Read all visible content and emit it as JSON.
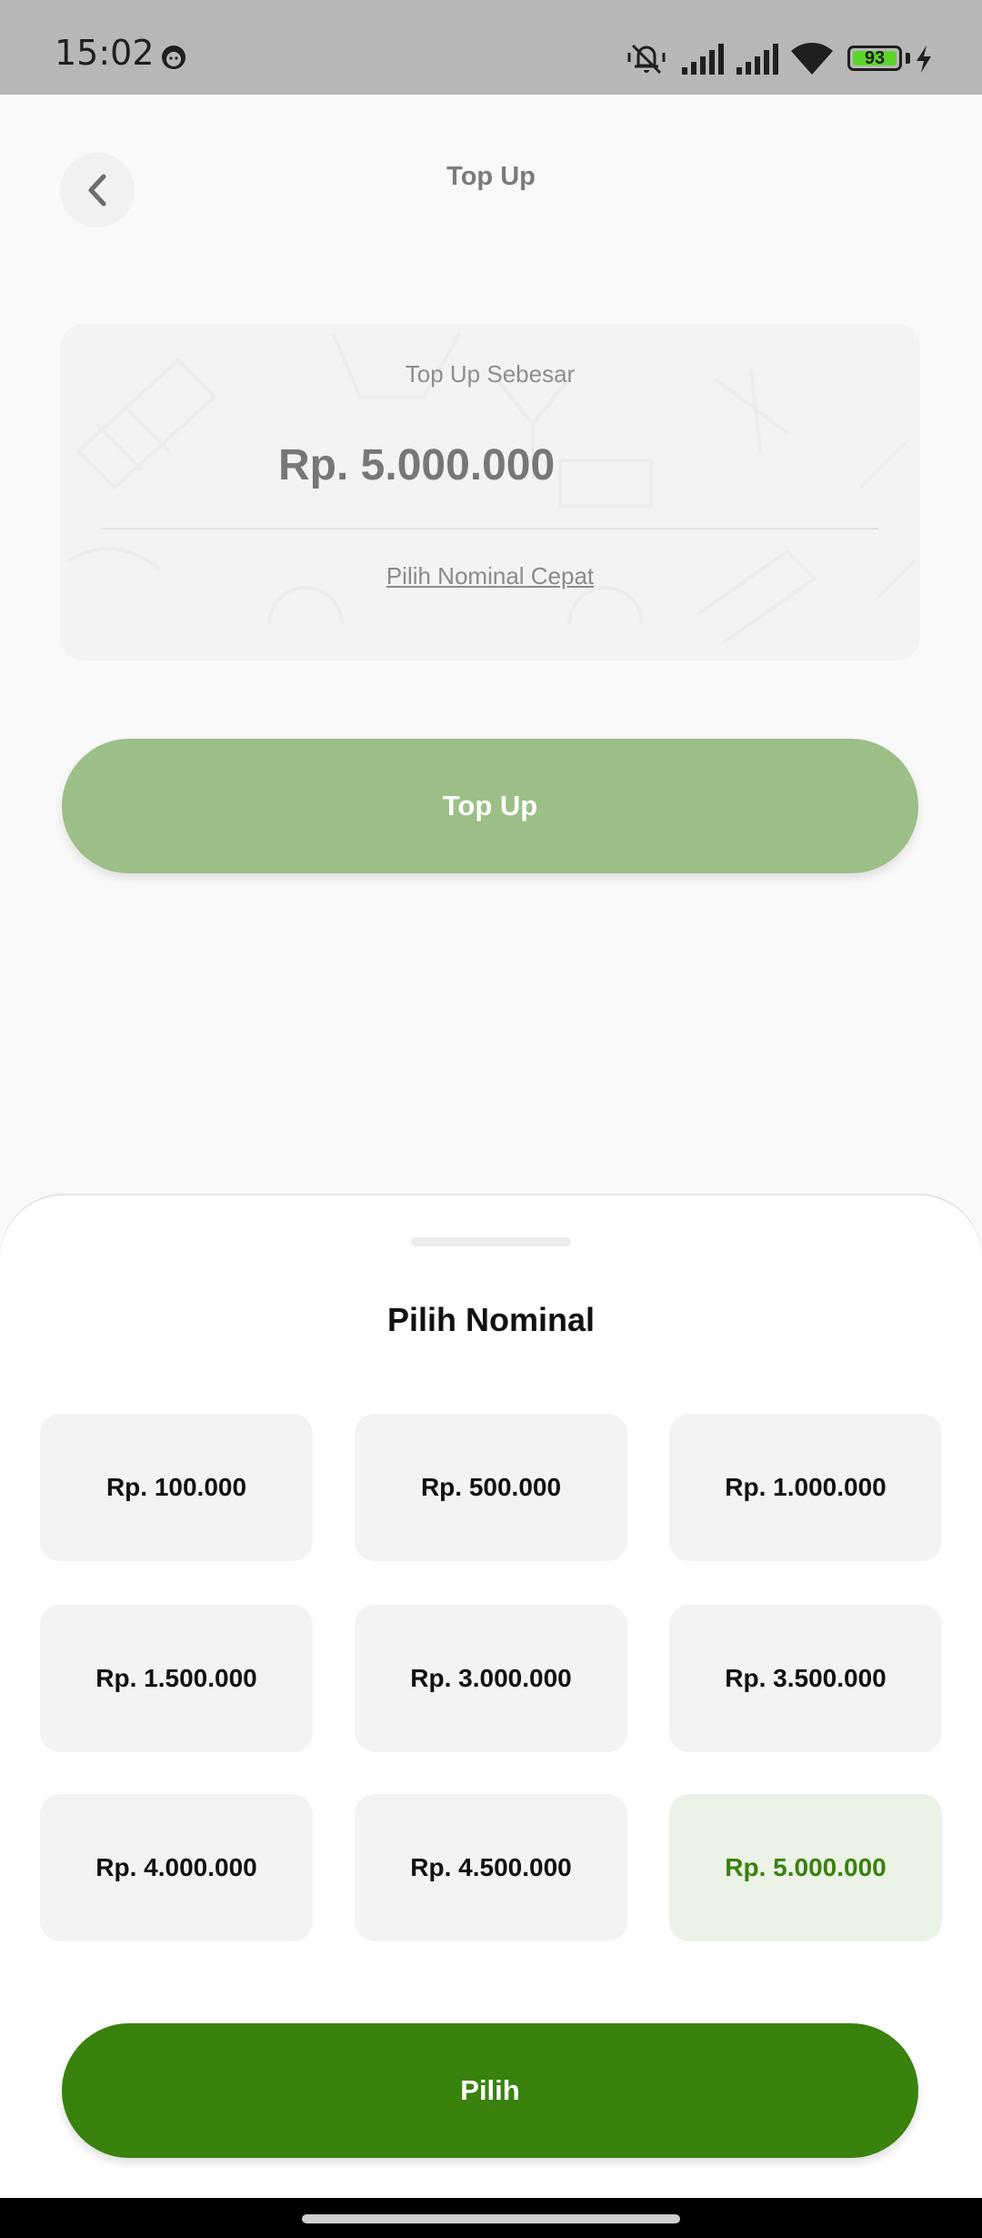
{
  "status_bar": {
    "time": "15:02",
    "battery_level": "93"
  },
  "header": {
    "title": "Top Up"
  },
  "amount_card": {
    "label": "Top Up Sebesar",
    "amount": "Rp. 5.000.000",
    "quick_link": "Pilih Nominal Cepat"
  },
  "topup_button": {
    "label": "Top Up"
  },
  "sheet": {
    "title": "Pilih Nominal",
    "options": [
      {
        "label": "Rp. 100.000",
        "selected": false
      },
      {
        "label": "Rp. 500.000",
        "selected": false
      },
      {
        "label": "Rp. 1.000.000",
        "selected": false
      },
      {
        "label": "Rp. 1.500.000",
        "selected": false
      },
      {
        "label": "Rp. 3.000.000",
        "selected": false
      },
      {
        "label": "Rp. 3.500.000",
        "selected": false
      },
      {
        "label": "Rp. 4.000.000",
        "selected": false
      },
      {
        "label": "Rp. 4.500.000",
        "selected": false
      },
      {
        "label": "Rp. 5.000.000",
        "selected": true
      }
    ],
    "confirm_label": "Pilih"
  },
  "colors": {
    "primary": "#38820d",
    "primary_dimmed": "#9bbf86",
    "selected_bg": "#ebf2e6",
    "status_bar": "#b7b7b7"
  },
  "icons": [
    "back-arrow-icon",
    "mute-icon",
    "signal-icon",
    "wifi-icon",
    "battery-icon",
    "charging-icon"
  ]
}
